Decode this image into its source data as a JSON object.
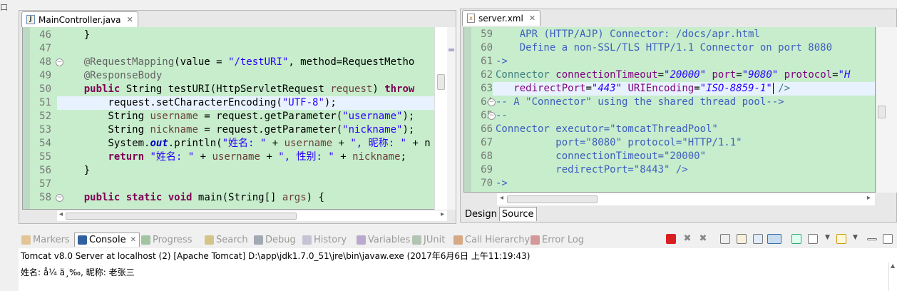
{
  "left_editor": {
    "tab_title": "MainController.java",
    "tab_icon": "java-file-icon",
    "lines": [
      {
        "num": "46",
        "segments": [
          {
            "t": "    }",
            "c": ""
          }
        ]
      },
      {
        "num": "47",
        "segments": [
          {
            "t": "",
            "c": ""
          }
        ]
      },
      {
        "num": "48",
        "fold": "minus",
        "segments": [
          {
            "t": "    ",
            "c": ""
          },
          {
            "t": "@RequestMapping",
            "c": "ann"
          },
          {
            "t": "(value = ",
            "c": ""
          },
          {
            "t": "\"/testURI\"",
            "c": "str"
          },
          {
            "t": ", method=RequestMetho",
            "c": ""
          }
        ]
      },
      {
        "num": "49",
        "segments": [
          {
            "t": "    ",
            "c": ""
          },
          {
            "t": "@ResponseBody",
            "c": "ann"
          }
        ]
      },
      {
        "num": "50",
        "segments": [
          {
            "t": "    ",
            "c": ""
          },
          {
            "t": "public",
            "c": "kw"
          },
          {
            "t": " String testURI(HttpServletRequest ",
            "c": ""
          },
          {
            "t": "request",
            "c": "var"
          },
          {
            "t": ") ",
            "c": ""
          },
          {
            "t": "throw",
            "c": "kw"
          }
        ]
      },
      {
        "num": "51",
        "current": true,
        "segments": [
          {
            "t": "        request.setCharacterEncoding(",
            "c": ""
          },
          {
            "t": "\"UTF-8\"",
            "c": "str"
          },
          {
            "t": ");",
            "c": ""
          }
        ]
      },
      {
        "num": "52",
        "segments": [
          {
            "t": "        String ",
            "c": ""
          },
          {
            "t": "username",
            "c": "var"
          },
          {
            "t": " = request.getParameter(",
            "c": ""
          },
          {
            "t": "\"username\"",
            "c": "str"
          },
          {
            "t": ");",
            "c": ""
          }
        ]
      },
      {
        "num": "53",
        "segments": [
          {
            "t": "        String ",
            "c": ""
          },
          {
            "t": "nickname",
            "c": "var"
          },
          {
            "t": " = request.getParameter(",
            "c": ""
          },
          {
            "t": "\"nickname\"",
            "c": "str"
          },
          {
            "t": ");",
            "c": ""
          }
        ]
      },
      {
        "num": "54",
        "segments": [
          {
            "t": "        System.",
            "c": ""
          },
          {
            "t": "out",
            "c": "fld"
          },
          {
            "t": ".println(",
            "c": ""
          },
          {
            "t": "\"姓名: \"",
            "c": "str"
          },
          {
            "t": " + ",
            "c": ""
          },
          {
            "t": "username",
            "c": "var"
          },
          {
            "t": " + ",
            "c": ""
          },
          {
            "t": "\", 昵称: \"",
            "c": "str"
          },
          {
            "t": " + n",
            "c": ""
          }
        ]
      },
      {
        "num": "55",
        "segments": [
          {
            "t": "        ",
            "c": ""
          },
          {
            "t": "return",
            "c": "kw"
          },
          {
            "t": " ",
            "c": ""
          },
          {
            "t": "\"姓名: \"",
            "c": "str"
          },
          {
            "t": " + ",
            "c": ""
          },
          {
            "t": "username",
            "c": "var"
          },
          {
            "t": " + ",
            "c": ""
          },
          {
            "t": "\", 性别: \"",
            "c": "str"
          },
          {
            "t": " + ",
            "c": ""
          },
          {
            "t": "nickname",
            "c": "var"
          },
          {
            "t": ";",
            "c": ""
          }
        ]
      },
      {
        "num": "56",
        "segments": [
          {
            "t": "    }",
            "c": ""
          }
        ]
      },
      {
        "num": "57",
        "segments": [
          {
            "t": "",
            "c": ""
          }
        ]
      },
      {
        "num": "58",
        "fold": "minus",
        "segments": [
          {
            "t": "    ",
            "c": ""
          },
          {
            "t": "public",
            "c": "kw"
          },
          {
            "t": " ",
            "c": ""
          },
          {
            "t": "static",
            "c": "kw"
          },
          {
            "t": " ",
            "c": ""
          },
          {
            "t": "void",
            "c": "kw"
          },
          {
            "t": " main(String[] ",
            "c": ""
          },
          {
            "t": "args",
            "c": "var"
          },
          {
            "t": ") {",
            "c": ""
          }
        ]
      }
    ]
  },
  "right_editor": {
    "tab_title": "server.xml",
    "tab_icon": "xml-file-icon",
    "lines": [
      {
        "num": "59",
        "segments": [
          {
            "t": "    APR (HTTP/AJP) Connector: /docs/apr.html",
            "c": "xcom"
          }
        ]
      },
      {
        "num": "60",
        "segments": [
          {
            "t": "    Define a non-SSL/TLS HTTP/1.1 Connector on port 8080",
            "c": "xcom"
          }
        ]
      },
      {
        "num": "61",
        "segments": [
          {
            "t": "->",
            "c": "xcom"
          }
        ]
      },
      {
        "num": "62",
        "segments": [
          {
            "t": "Connector",
            "c": "xtag"
          },
          {
            "t": " ",
            "c": ""
          },
          {
            "t": "connectionTimeout",
            "c": "xattr"
          },
          {
            "t": "=",
            "c": ""
          },
          {
            "t": "\"20000\"",
            "c": "xval"
          },
          {
            "t": " ",
            "c": ""
          },
          {
            "t": "port",
            "c": "xattr"
          },
          {
            "t": "=",
            "c": ""
          },
          {
            "t": "\"9080\"",
            "c": "xval"
          },
          {
            "t": " ",
            "c": ""
          },
          {
            "t": "protocol",
            "c": "xattr"
          },
          {
            "t": "=",
            "c": ""
          },
          {
            "t": "\"H",
            "c": "xval"
          }
        ]
      },
      {
        "num": "63",
        "current": true,
        "segments": [
          {
            "t": "   ",
            "c": ""
          },
          {
            "t": "redirectPort",
            "c": "xattr"
          },
          {
            "t": "=",
            "c": ""
          },
          {
            "t": "\"443\"",
            "c": "xval"
          },
          {
            "t": " ",
            "c": ""
          },
          {
            "t": "URIEncoding",
            "c": "xattr"
          },
          {
            "t": "=",
            "c": ""
          },
          {
            "t": "\"ISO-8859-1\"",
            "c": "xval"
          },
          {
            "t": " ",
            "c": ""
          },
          {
            "t": "/>",
            "c": "xtag"
          }
        ]
      },
      {
        "num": "64",
        "fold": "minus",
        "segments": [
          {
            "t": "-- A \"Connector\" using the shared thread pool-->",
            "c": "xcom"
          }
        ]
      },
      {
        "num": "65",
        "fold": "minus",
        "segments": [
          {
            "t": "--",
            "c": "xcom"
          }
        ]
      },
      {
        "num": "66",
        "segments": [
          {
            "t": "Connector executor=\"tomcatThreadPool\"",
            "c": "xcom"
          }
        ]
      },
      {
        "num": "67",
        "segments": [
          {
            "t": "          port=\"8080\" protocol=\"HTTP/1.1\"",
            "c": "xcom"
          }
        ]
      },
      {
        "num": "68",
        "segments": [
          {
            "t": "          connectionTimeout=\"20000\"",
            "c": "xcom"
          }
        ]
      },
      {
        "num": "69",
        "segments": [
          {
            "t": "          redirectPort=\"8443\" />",
            "c": "xcom"
          }
        ]
      },
      {
        "num": "70",
        "segments": [
          {
            "t": "->",
            "c": "xcom"
          }
        ]
      }
    ],
    "bottom_tabs": [
      "Design",
      "Source"
    ]
  },
  "bottom_panel": {
    "tabs": [
      {
        "label": "Markers",
        "icon": "markers-icon",
        "active": false
      },
      {
        "label": "Console",
        "icon": "console-icon",
        "active": true
      },
      {
        "label": "Progress",
        "icon": "progress-icon",
        "active": false
      },
      {
        "label": "Search",
        "icon": "search-icon",
        "active": false
      },
      {
        "label": "Debug",
        "icon": "debug-icon",
        "active": false
      },
      {
        "label": "History",
        "icon": "history-icon",
        "active": false
      },
      {
        "label": "Variables",
        "icon": "variables-icon",
        "active": false
      },
      {
        "label": "JUnit",
        "icon": "junit-icon",
        "active": false
      },
      {
        "label": "Call Hierarchy",
        "icon": "call-hierarchy-icon",
        "active": false
      },
      {
        "label": "Error Log",
        "icon": "error-log-icon",
        "active": false
      }
    ],
    "console_header": "Tomcat v8.0 Server at localhost (2) [Apache Tomcat] D:\\app\\jdk1.7.0_51\\jre\\bin\\javaw.exe (2017年6月6日 上午11:19:43)",
    "console_output": "姓名: å¼ ä¸‰, 昵称: 老张三"
  },
  "top_left_glyph": "口",
  "colors": {
    "editor_bg": "#c7edcc",
    "current_line": "#e8f2fe",
    "keyword": "#7f0055",
    "string": "#2a00ff"
  }
}
